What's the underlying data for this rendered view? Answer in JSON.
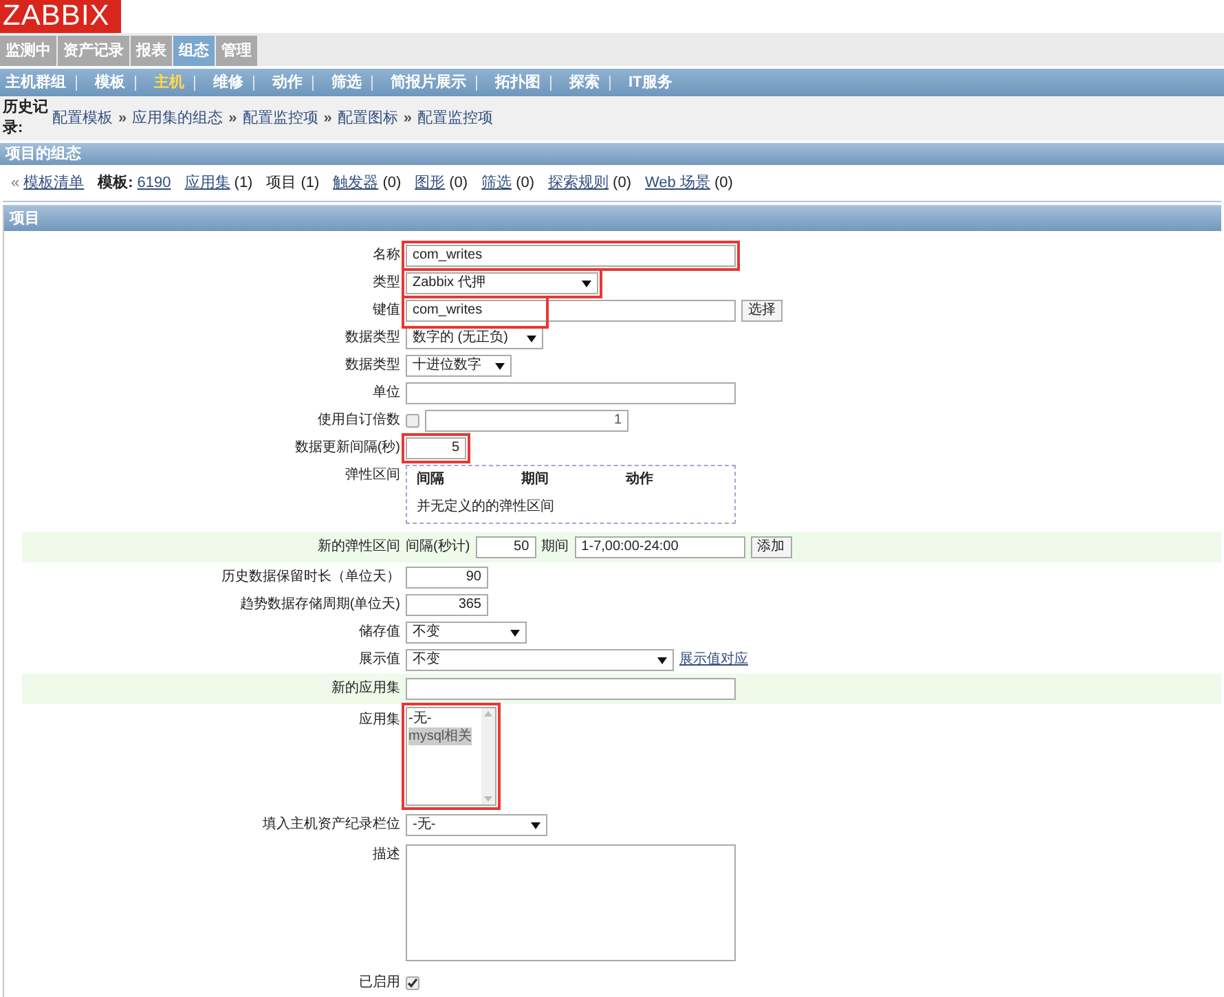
{
  "logo": "ZABBIX",
  "main_menu": [
    {
      "label": "监测中",
      "selected": false
    },
    {
      "label": "资产记录",
      "selected": false
    },
    {
      "label": "报表",
      "selected": false
    },
    {
      "label": "组态",
      "selected": true
    },
    {
      "label": "管理",
      "selected": false
    }
  ],
  "sub_menu": [
    {
      "label": "主机群组",
      "selected": false
    },
    {
      "label": "模板",
      "selected": false
    },
    {
      "label": "主机",
      "selected": true
    },
    {
      "label": "维修",
      "selected": false
    },
    {
      "label": "动作",
      "selected": false
    },
    {
      "label": "筛选",
      "selected": false
    },
    {
      "label": "简报片展示",
      "selected": false
    },
    {
      "label": "拓扑图",
      "selected": false
    },
    {
      "label": "探索",
      "selected": false
    },
    {
      "label": "IT服务",
      "selected": false
    }
  ],
  "history": {
    "label": "历史记录:",
    "separator": "»",
    "items": [
      "配置模板",
      "应用集的组态",
      "配置监控项",
      "配置图标",
      "配置监控项"
    ]
  },
  "section_title": "项目的组态",
  "crumbs": [
    {
      "kind": "back",
      "arrow": "«",
      "label": "模板清单"
    },
    {
      "kind": "heading",
      "label": "模板:"
    },
    {
      "kind": "link",
      "label": "6190"
    },
    {
      "kind": "link",
      "label": "应用集",
      "count": "(1)"
    },
    {
      "kind": "text",
      "label": "项目",
      "count": "(1)"
    },
    {
      "kind": "link",
      "label": "触发器",
      "count": "(0)"
    },
    {
      "kind": "link",
      "label": "图形",
      "count": "(0)"
    },
    {
      "kind": "link",
      "label": "筛选",
      "count": "(0)"
    },
    {
      "kind": "link",
      "label": "探索规则",
      "count": "(0)"
    },
    {
      "kind": "link",
      "label": "Web 场景",
      "count": "(0)"
    }
  ],
  "form": {
    "title": "项目",
    "rows": [
      {
        "kind": "input",
        "label": "名称",
        "value": "com_writes",
        "highlighted": true
      },
      {
        "kind": "select",
        "label": "类型",
        "value": "Zabbix 代押",
        "highlighted": true
      },
      {
        "kind": "input_button",
        "label": "键值",
        "value": "com_writes",
        "button": "选择",
        "highlighted": true
      },
      {
        "kind": "select",
        "label": "数据类型",
        "value": "数字的 (无正负)"
      },
      {
        "kind": "select",
        "label": "数据类型",
        "value": "十进位数字"
      },
      {
        "kind": "input",
        "label": "单位"
      },
      {
        "kind": "multiplier",
        "label": "使用自订倍数",
        "checked": false,
        "value": "1"
      },
      {
        "kind": "number",
        "label": "数据更新间隔(秒)",
        "value": "5",
        "highlighted": true
      },
      {
        "kind": "intervals",
        "label": "弹性区间",
        "columns": [
          "间隔",
          "期间",
          "动作"
        ],
        "empty_text": "并无定义的的弹性区间"
      },
      {
        "kind": "new_interval",
        "label": "新的弹性区间",
        "interval_label": "间隔(秒计)",
        "interval": "50",
        "period_label": "期间",
        "period": "1-7,00:00-24:00",
        "button": "添加",
        "shaded": true
      },
      {
        "kind": "number",
        "label": "历史数据保留时长（单位天）",
        "value": "90"
      },
      {
        "kind": "number",
        "label": "趋势数据存储周期(单位天)",
        "value": "365"
      },
      {
        "kind": "select",
        "label": "储存值",
        "value": "不变"
      },
      {
        "kind": "select_link",
        "label": "展示值",
        "value": "不变",
        "link": "展示值对应"
      },
      {
        "kind": "input",
        "label": "新的应用集",
        "shaded": true
      },
      {
        "kind": "listbox",
        "label": "应用集",
        "options": [
          {
            "label": "-无-",
            "selected": false
          },
          {
            "label": "mysql相关",
            "selected": true
          }
        ],
        "highlighted": true
      },
      {
        "kind": "select",
        "label": "填入主机资产纪录栏位",
        "value": "-无-"
      },
      {
        "kind": "textarea",
        "label": "描述"
      },
      {
        "kind": "checkbox",
        "label": "已启用",
        "checked": true
      }
    ]
  }
}
